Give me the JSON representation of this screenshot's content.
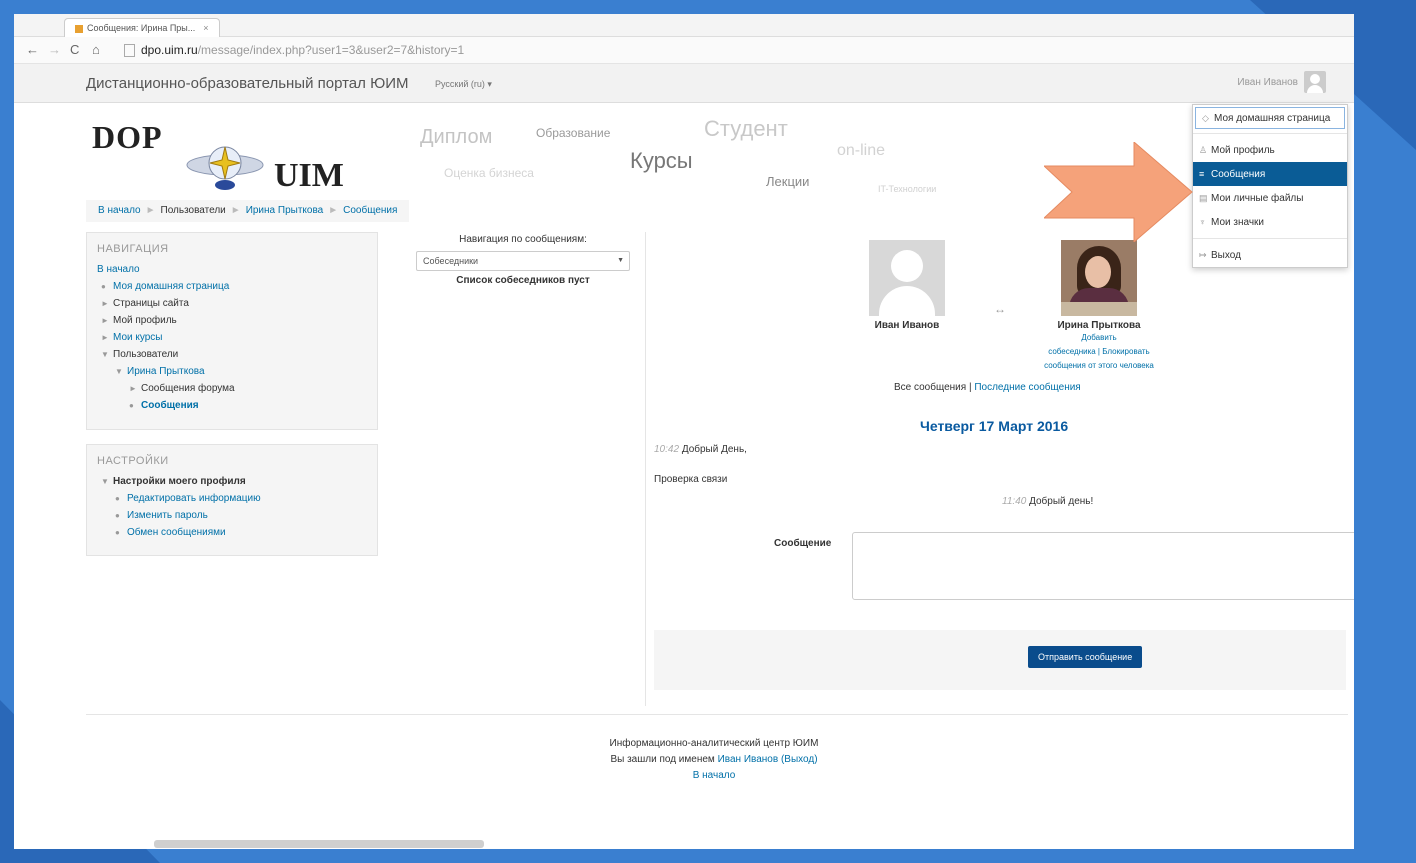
{
  "browser": {
    "tab_title": "Сообщения: Ирина Пры...",
    "tab_close": "×",
    "url_host": "dpo.uim.ru",
    "url_path": "/message/index.php?user1=3&user2=7&history=1"
  },
  "navbar": {
    "site_title": "Дистанционно-образовательный портал ЮИМ",
    "language": "Русский (ru) ▾",
    "user_name": "Иван Иванов"
  },
  "logo": {
    "top": "DOP",
    "bottom": "UIM"
  },
  "tag_cloud": [
    "Диплом",
    "Образование",
    "Студент",
    "Курсы",
    "on-line",
    "Оценка бизнеса",
    "Лекции",
    "IT-Технологии"
  ],
  "breadcrumb": [
    "В начало",
    "Пользователи",
    "Ирина Прыткова",
    "Сообщения"
  ],
  "navigation": {
    "title": "НАВИГАЦИЯ",
    "items": [
      "В начало",
      "Моя домашняя страница",
      "Страницы сайта",
      "Мой профиль",
      "Мои курсы",
      "Пользователи",
      "Ирина Прыткова",
      "Сообщения форума",
      "Сообщения"
    ]
  },
  "settings": {
    "title": "НАСТРОЙКИ",
    "items": [
      "Настройки моего профиля",
      "Редактировать информацию",
      "Изменить пароль",
      "Обмен сообщениями"
    ]
  },
  "message_nav": {
    "label": "Навигация по сообщениям:",
    "selected": "Собеседники",
    "empty": "Список собеседников пуст"
  },
  "conversation": {
    "user1": "Иван Иванов",
    "user2": "Ирина Прыткова",
    "swap": "↔",
    "actions": [
      "Добавить",
      "собеседника | Блокировать",
      "сообщения от этого человека"
    ],
    "all_messages": "Все сообщения",
    "recent_messages": "Последние сообщения",
    "date": "Четверг 17 Март 2016",
    "messages": [
      {
        "time": "10:42",
        "text": "Добрый День,"
      },
      {
        "time": "",
        "text": "Проверка связи"
      },
      {
        "time": "11:40",
        "text": "Добрый день!"
      }
    ],
    "compose_label": "Сообщение",
    "send_button": "Отправить сообщение"
  },
  "footer": {
    "org": "Информационно-аналитический центр ЮИМ",
    "logged_prefix": "Вы зашли под именем",
    "user": "Иван Иванов",
    "logout": "(Выход)",
    "home": "В начало"
  },
  "user_menu": [
    "Моя домашняя страница",
    "Мой профиль",
    "Сообщения",
    "Мои личные файлы",
    "Мои значки",
    "Выход"
  ],
  "colors": {
    "accent": "#0a5c96",
    "link": "#0070a8",
    "frame": "#3a7fd0",
    "highlight_arrow": "#f5a27a"
  }
}
